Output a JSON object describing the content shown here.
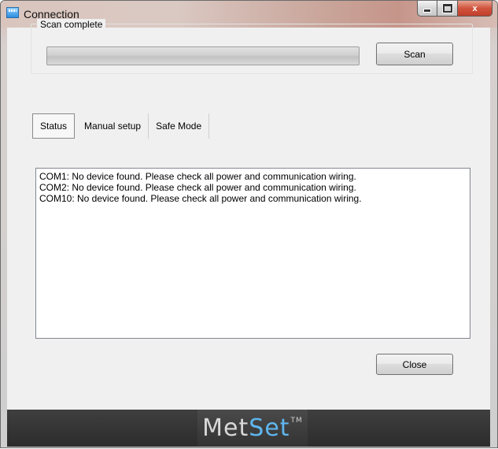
{
  "window": {
    "title": "Connection",
    "close_glyph": "x"
  },
  "scan": {
    "group_label": "Scan complete",
    "progress_fraction": 0,
    "scan_button": "Scan"
  },
  "tabs": [
    {
      "label": "Status",
      "active": true
    },
    {
      "label": "Manual setup",
      "active": false
    },
    {
      "label": "Safe Mode",
      "active": false
    }
  ],
  "status": {
    "lines": [
      "COM1: No device found. Please check all power and communication wiring.",
      "COM2: No device found. Please check all power and communication wiring.",
      "COM10: No device found. Please check all power and communication wiring."
    ]
  },
  "footer": {
    "close_button": "Close",
    "logo_met": "Met",
    "logo_set": "Set",
    "logo_tm": "TM"
  },
  "colors": {
    "logo_accent": "#5fb6ee",
    "footer_bg": "#333333"
  },
  "icons": {
    "app": "app-window-icon",
    "minimize": "minimize-icon",
    "maximize": "maximize-icon",
    "close": "close-icon"
  }
}
